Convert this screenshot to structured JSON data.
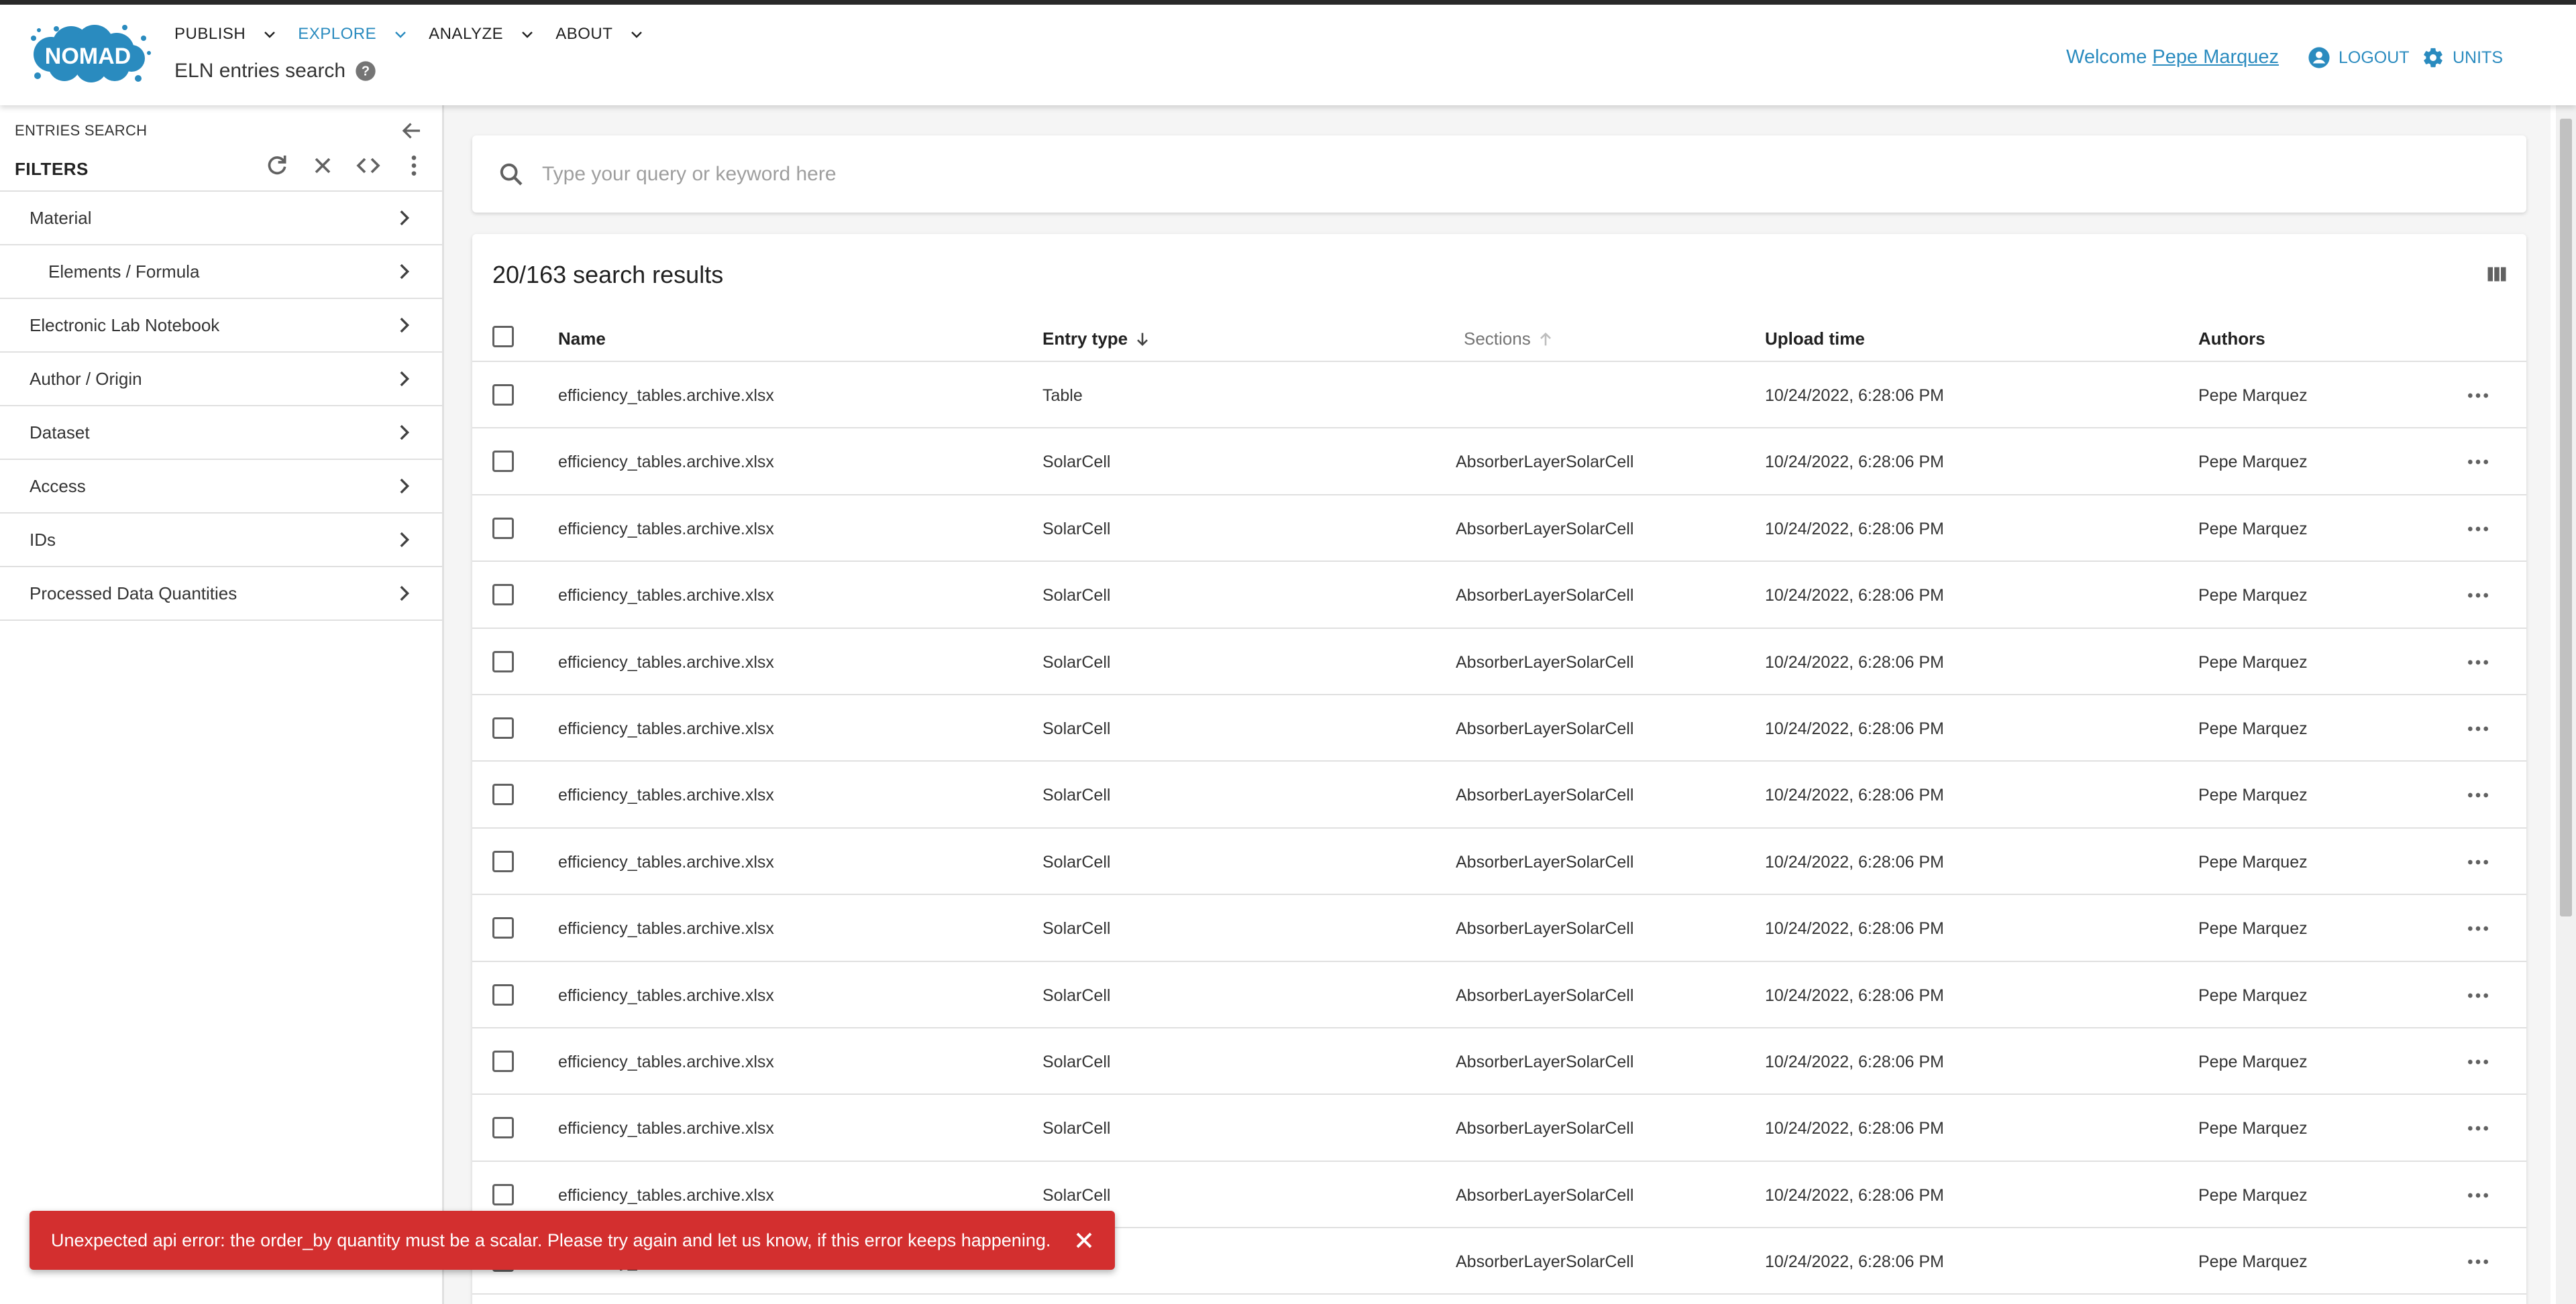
{
  "header": {
    "logo_text": "NOMAD",
    "nav": [
      {
        "label": "PUBLISH",
        "active": false
      },
      {
        "label": "EXPLORE",
        "active": true
      },
      {
        "label": "ANALYZE",
        "active": false
      },
      {
        "label": "ABOUT",
        "active": false
      }
    ],
    "page_title": "ELN entries search",
    "welcome_prefix": "Welcome",
    "user_name": "Pepe Marquez",
    "logout_label": "LOGOUT",
    "units_label": "UNITS",
    "accent_color": "#2a8bbf"
  },
  "sidebar": {
    "caption": "ENTRIES SEARCH",
    "filters_title": "FILTERS",
    "items": [
      {
        "label": "Material"
      },
      {
        "label": "Elements / Formula"
      },
      {
        "label": "Electronic Lab Notebook"
      },
      {
        "label": "Author / Origin"
      },
      {
        "label": "Dataset"
      },
      {
        "label": "Access"
      },
      {
        "label": "IDs"
      },
      {
        "label": "Processed Data Quantities"
      }
    ]
  },
  "search": {
    "placeholder": "Type your query or keyword here"
  },
  "results": {
    "summary": "20/163 search results",
    "columns": {
      "name": "Name",
      "entry_type": "Entry type",
      "sections": "Sections",
      "upload_time": "Upload time",
      "authors": "Authors"
    },
    "rows": [
      {
        "name": "efficiency_tables.archive.xlsx",
        "entry_type": "Table",
        "sections": "",
        "upload_time": "10/24/2022, 6:28:06 PM",
        "authors": "Pepe Marquez"
      },
      {
        "name": "efficiency_tables.archive.xlsx",
        "entry_type": "SolarCell",
        "sections": "AbsorberLayerSolarCell",
        "upload_time": "10/24/2022, 6:28:06 PM",
        "authors": "Pepe Marquez"
      },
      {
        "name": "efficiency_tables.archive.xlsx",
        "entry_type": "SolarCell",
        "sections": "AbsorberLayerSolarCell",
        "upload_time": "10/24/2022, 6:28:06 PM",
        "authors": "Pepe Marquez"
      },
      {
        "name": "efficiency_tables.archive.xlsx",
        "entry_type": "SolarCell",
        "sections": "AbsorberLayerSolarCell",
        "upload_time": "10/24/2022, 6:28:06 PM",
        "authors": "Pepe Marquez"
      },
      {
        "name": "efficiency_tables.archive.xlsx",
        "entry_type": "SolarCell",
        "sections": "AbsorberLayerSolarCell",
        "upload_time": "10/24/2022, 6:28:06 PM",
        "authors": "Pepe Marquez"
      },
      {
        "name": "efficiency_tables.archive.xlsx",
        "entry_type": "SolarCell",
        "sections": "AbsorberLayerSolarCell",
        "upload_time": "10/24/2022, 6:28:06 PM",
        "authors": "Pepe Marquez"
      },
      {
        "name": "efficiency_tables.archive.xlsx",
        "entry_type": "SolarCell",
        "sections": "AbsorberLayerSolarCell",
        "upload_time": "10/24/2022, 6:28:06 PM",
        "authors": "Pepe Marquez"
      },
      {
        "name": "efficiency_tables.archive.xlsx",
        "entry_type": "SolarCell",
        "sections": "AbsorberLayerSolarCell",
        "upload_time": "10/24/2022, 6:28:06 PM",
        "authors": "Pepe Marquez"
      },
      {
        "name": "efficiency_tables.archive.xlsx",
        "entry_type": "SolarCell",
        "sections": "AbsorberLayerSolarCell",
        "upload_time": "10/24/2022, 6:28:06 PM",
        "authors": "Pepe Marquez"
      },
      {
        "name": "efficiency_tables.archive.xlsx",
        "entry_type": "SolarCell",
        "sections": "AbsorberLayerSolarCell",
        "upload_time": "10/24/2022, 6:28:06 PM",
        "authors": "Pepe Marquez"
      },
      {
        "name": "efficiency_tables.archive.xlsx",
        "entry_type": "SolarCell",
        "sections": "AbsorberLayerSolarCell",
        "upload_time": "10/24/2022, 6:28:06 PM",
        "authors": "Pepe Marquez"
      },
      {
        "name": "efficiency_tables.archive.xlsx",
        "entry_type": "SolarCell",
        "sections": "AbsorberLayerSolarCell",
        "upload_time": "10/24/2022, 6:28:06 PM",
        "authors": "Pepe Marquez"
      },
      {
        "name": "efficiency_tables.archive.xlsx",
        "entry_type": "SolarCell",
        "sections": "AbsorberLayerSolarCell",
        "upload_time": "10/24/2022, 6:28:06 PM",
        "authors": "Pepe Marquez"
      },
      {
        "name": "efficiency_tables.archive.xlsx",
        "entry_type": "SolarCell",
        "sections": "AbsorberLayerSolarCell",
        "upload_time": "10/24/2022, 6:28:06 PM",
        "authors": "Pepe Marquez"
      }
    ]
  },
  "snackbar": {
    "message": "Unexpected api error: the order_by quantity must be a scalar. Please try again and let us know, if this error keeps happening.",
    "color": "#d32f2f"
  }
}
